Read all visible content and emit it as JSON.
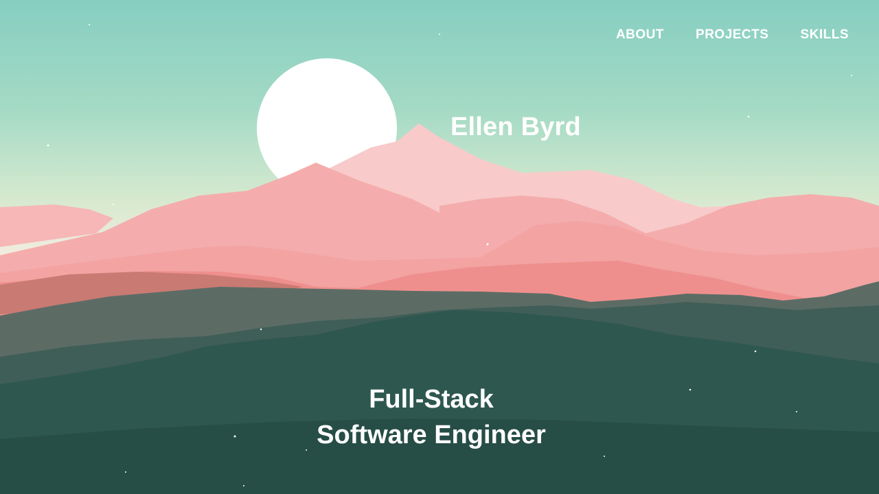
{
  "nav": {
    "items": [
      {
        "label": "ABOUT"
      },
      {
        "label": "PROJECTS"
      },
      {
        "label": "SKILLS"
      }
    ]
  },
  "hero": {
    "name": "Ellen Byrd",
    "role_line_1": "Full-Stack",
    "role_line_2": "Software Engineer"
  },
  "colors": {
    "sky_top": "#86cec1",
    "sky_horizon": "#f3ece0",
    "sun": "#ffffff",
    "mountains_pink": "#f5a9a8",
    "mountains_green": "#2e574f",
    "text": "#ffffff"
  }
}
